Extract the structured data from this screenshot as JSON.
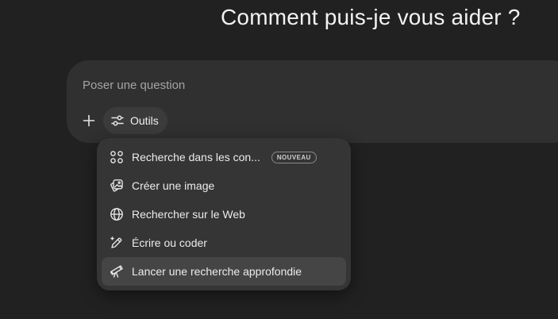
{
  "heading": "Comment puis-je vous aider ?",
  "composer": {
    "placeholder": "Poser une question",
    "add_icon": "plus-icon",
    "tools_label": "Outils",
    "tools_icon": "sliders-icon"
  },
  "menu": {
    "items": [
      {
        "label": "Recherche dans les con...",
        "icon": "connectors-icon",
        "badge": "NOUVEAU",
        "active": false
      },
      {
        "label": "Créer une image",
        "icon": "image-icon",
        "active": false
      },
      {
        "label": "Rechercher sur le Web",
        "icon": "globe-icon",
        "active": false
      },
      {
        "label": "Écrire ou coder",
        "icon": "pen-sparkle-icon",
        "active": false
      },
      {
        "label": "Lancer une recherche approfondie",
        "icon": "telescope-icon",
        "active": true
      }
    ]
  },
  "colors": {
    "background": "#212121",
    "composer": "#303030",
    "menu": "#353535",
    "menu_hover": "#454545",
    "text": "#ececec"
  }
}
